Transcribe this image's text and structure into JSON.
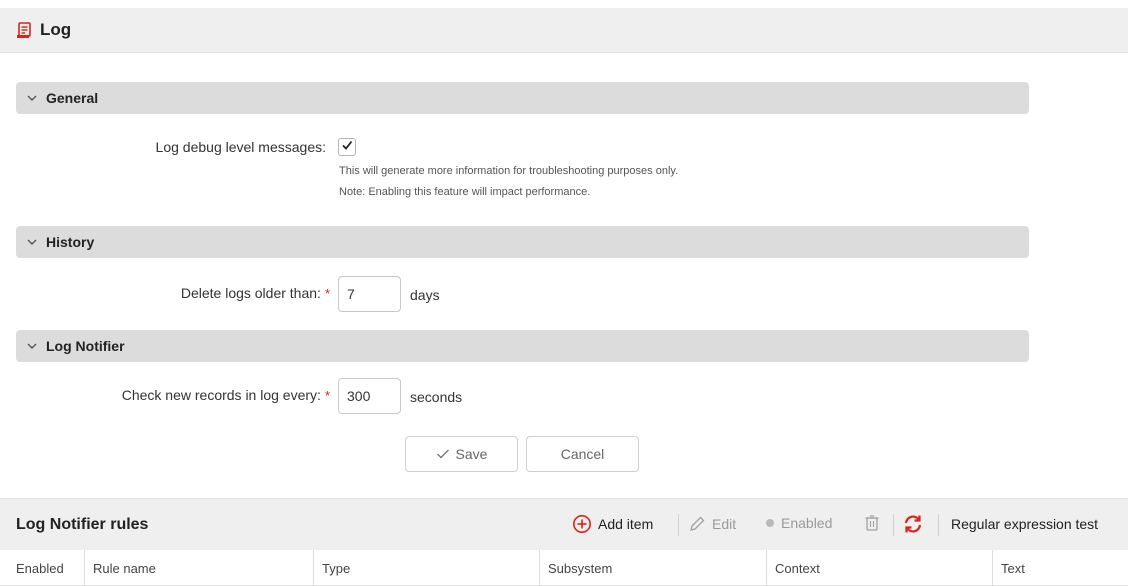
{
  "header": {
    "title": "Log",
    "icon": "log-icon"
  },
  "sections": {
    "general": {
      "title": "General",
      "debug_label": "Log debug level messages:",
      "debug_checked": true,
      "hint_line1": "This will generate more information for troubleshooting purposes only.",
      "hint_line2": "Note: Enabling this feature will impact performance."
    },
    "history": {
      "title": "History",
      "delete_label": "Delete logs older than:",
      "delete_value": "7",
      "delete_unit": "days"
    },
    "notifier": {
      "title": "Log Notifier",
      "check_label": "Check new records in log every:",
      "check_value": "300",
      "check_unit": "seconds"
    }
  },
  "required_mark": "*",
  "buttons": {
    "save": "Save",
    "cancel": "Cancel"
  },
  "rules": {
    "title": "Log Notifier rules",
    "toolbar": {
      "add": "Add item",
      "edit": "Edit",
      "enabled": "Enabled",
      "regex_test": "Regular expression test"
    },
    "columns": [
      "Enabled",
      "Rule name",
      "Type",
      "Subsystem",
      "Context",
      "Text"
    ]
  },
  "colors": {
    "accent": "#d9241c",
    "section_bg": "#dcdcdc",
    "header_bg": "#efefef"
  }
}
